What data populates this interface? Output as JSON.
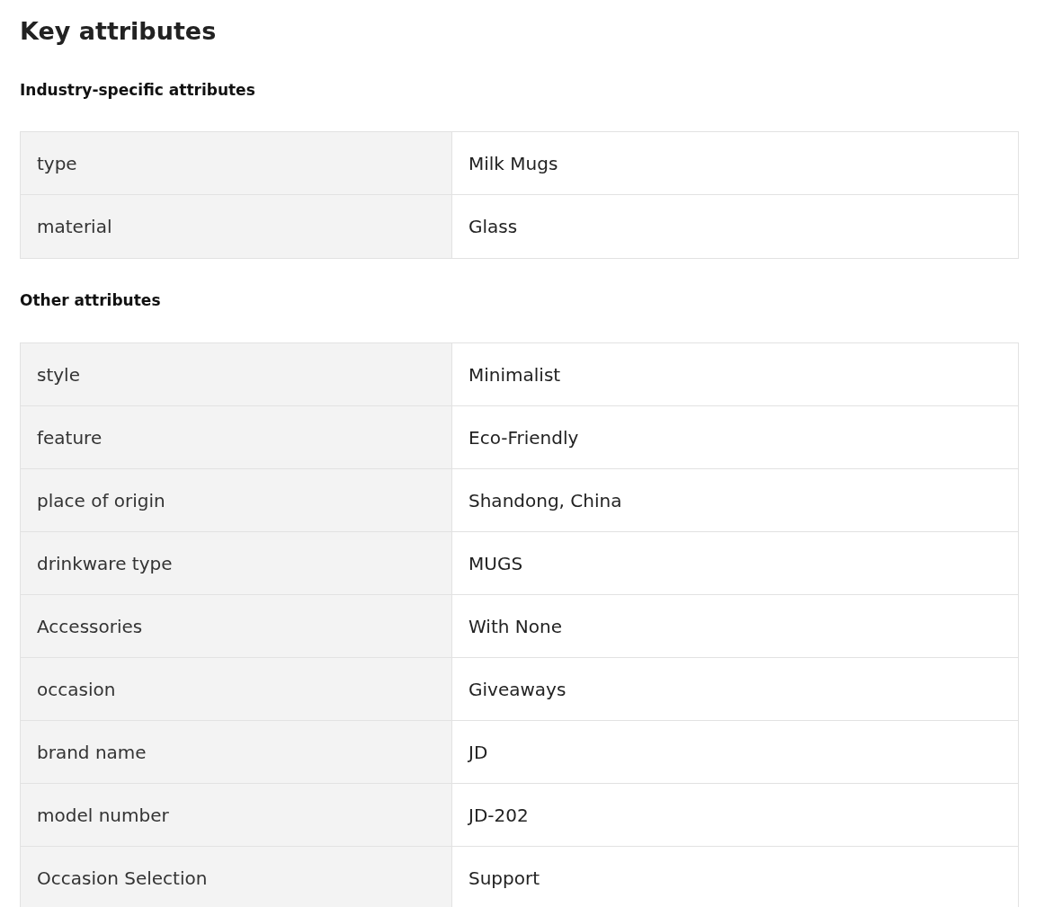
{
  "title": "Key attributes",
  "sections": [
    {
      "heading": "Industry-specific attributes",
      "rows": [
        {
          "label": "type",
          "value": "Milk Mugs"
        },
        {
          "label": "material",
          "value": "Glass"
        }
      ]
    },
    {
      "heading": "Other attributes",
      "rows": [
        {
          "label": "style",
          "value": "Minimalist"
        },
        {
          "label": "feature",
          "value": "Eco-Friendly"
        },
        {
          "label": "place of origin",
          "value": "Shandong, China"
        },
        {
          "label": "drinkware type",
          "value": "MUGS"
        },
        {
          "label": "Accessories",
          "value": "With None"
        },
        {
          "label": "occasion",
          "value": "Giveaways"
        },
        {
          "label": "brand name",
          "value": "JD"
        },
        {
          "label": "model number",
          "value": "JD-202"
        },
        {
          "label": "Occasion Selection",
          "value": "Support"
        }
      ]
    }
  ]
}
